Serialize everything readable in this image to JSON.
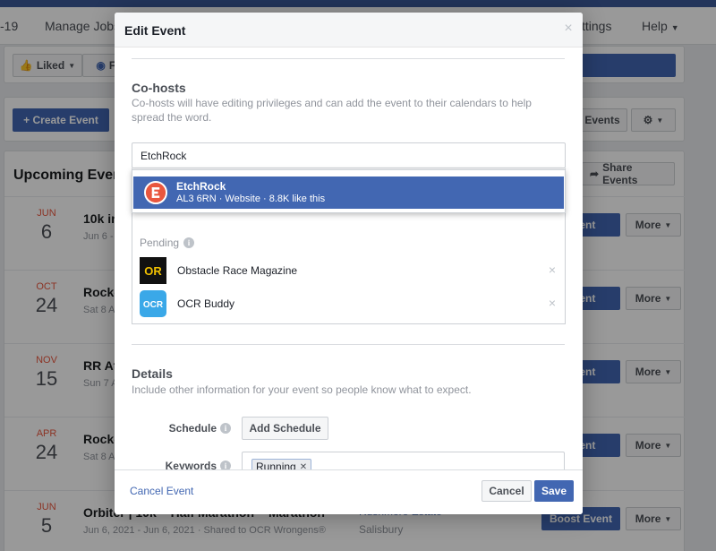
{
  "nav": {
    "items": [
      "-19",
      "Manage Jobs",
      "ttings",
      "Help"
    ]
  },
  "toolbar": {
    "liked_label": "Liked",
    "follow_label": "Fo",
    "create_event_label": "+ Create Event",
    "events_label": "Events"
  },
  "upcoming": {
    "title": "Upcoming Event",
    "share_label": "Share Events",
    "events": [
      {
        "month": "JUN",
        "day": "6",
        "title": "10k in",
        "sub": "Jun 6 -",
        "place": "",
        "city": "",
        "boost": "Event",
        "more": "More"
      },
      {
        "month": "OCT",
        "day": "24",
        "title": "Rocke",
        "sub": "Sat 8 A",
        "place": "",
        "city": "",
        "boost": "Event",
        "more": "More"
      },
      {
        "month": "NOV",
        "day": "15",
        "title": "RR Atl",
        "sub": "Sun 7 A",
        "place": "",
        "city": "",
        "boost": "Event",
        "more": "More"
      },
      {
        "month": "APR",
        "day": "24",
        "title": "Rocke",
        "sub": "Sat 8 A",
        "place": "",
        "city": "",
        "boost": "Event",
        "more": "More"
      },
      {
        "month": "JUN",
        "day": "5",
        "title": "Orbiter | 10k ~ Half Marathon ~ Marathon",
        "sub": "Jun 6, 2021 - Jun 6, 2021 · Shared to OCR Wrongens®",
        "place": "Rushmore Estate",
        "city": "Salisbury",
        "boost": "Boost Event",
        "more": "More"
      }
    ]
  },
  "dialog": {
    "title": "Edit Event",
    "cohosts": {
      "heading": "Co-hosts",
      "help": "Co-hosts will have editing privileges and can add the event to their calendars to help spread the word.",
      "input_value": "EtchRock",
      "pending_label": "Pending",
      "pending": [
        {
          "name": "Obstacle Race Magazine",
          "logo": "OR"
        },
        {
          "name": "OCR Buddy",
          "logo": "OCR"
        }
      ]
    },
    "suggestion": {
      "name": "EtchRock",
      "subtitle": "AL3 6RN · Website · 8.8K like this"
    },
    "details": {
      "heading": "Details",
      "help": "Include other information for your event so people know what to expect.",
      "schedule_label": "Schedule",
      "add_schedule_label": "Add Schedule",
      "keywords_label": "Keywords",
      "keyword_token": "Running"
    },
    "footer": {
      "cancel_event_label": "Cancel Event",
      "cancel_label": "Cancel",
      "save_label": "Save"
    }
  },
  "colors": {
    "primary": "#4267b2",
    "date_accent": "#e9573f",
    "etchrock_orange": "#e9573f"
  }
}
